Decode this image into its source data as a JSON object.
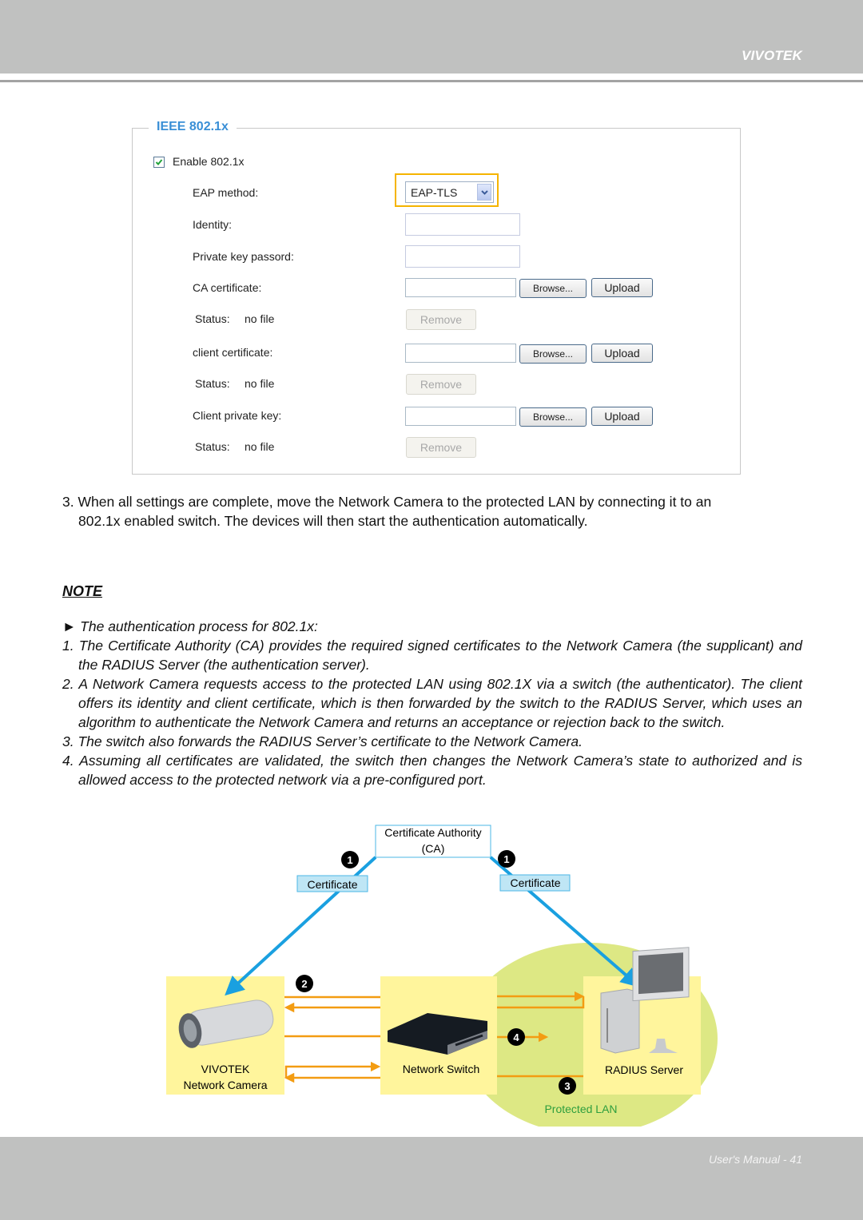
{
  "header": {
    "brand": "VIVOTEK"
  },
  "footer": {
    "page_label": "User's Manual - 41"
  },
  "settings": {
    "legend": "IEEE 802.1x",
    "enable_label": "Enable 802.1x",
    "enable_checked": true,
    "eap_method_label": "EAP method:",
    "eap_method_value": "EAP-TLS",
    "identity_label": "Identity:",
    "identity_value": "",
    "private_key_password_label": "Private key passord:",
    "private_key_password_value": "",
    "ca_certificate_label": "CA certificate:",
    "client_certificate_label": "client certificate:",
    "client_private_key_label": "Client private key:",
    "status_label": "Status:",
    "status_value": "no file",
    "browse_label": "Browse...",
    "upload_label": "Upload",
    "remove_label": "Remove"
  },
  "step3": {
    "line1": "3. When all settings are complete, move the Network Camera to the protected LAN by connecting it to an",
    "line2": "802.1x enabled switch. The devices will then start the authentication automatically."
  },
  "note": {
    "title": "NOTE",
    "intro": "► The authentication process for 802.1x:",
    "items": [
      "1. The Certificate Authority (CA) provides the required signed certificates to the Network Camera (the supplicant) and the RADIUS Server (the authentication server).",
      "2. A Network Camera requests access to the protected LAN using 802.1X via a switch (the authenticator). The client offers its identity and client certificate, which is then forwarded by the switch to the RADIUS Server, which uses an algorithm to authenticate the Network Camera and returns an acceptance or rejection back to the switch.",
      "3. The switch also forwards the RADIUS Server’s certificate to the Network Camera.",
      "4. Assuming all certificates are validated, the switch then changes the Network Camera’s state to authorized and is allowed access to the protected network via a pre-configured port."
    ]
  },
  "diagram": {
    "ca_line1": "Certificate Authority",
    "ca_line2": "(CA)",
    "certificate_left": "Certificate",
    "certificate_right": "Certificate",
    "camera_line1": "VIVOTEK",
    "camera_line2": "Network Camera",
    "switch_label": "Network Switch",
    "radius_label": "RADIUS Server",
    "protected_lan": "Protected LAN",
    "step_badges": [
      "1",
      "1",
      "2",
      "3",
      "4"
    ],
    "colors": {
      "cert_line": "#1aa0e0",
      "flow_arrow": "#f39c12",
      "lan_zone": "#dde884",
      "device_box": "#fff59c",
      "protected_text": "#2e9e3e"
    }
  }
}
